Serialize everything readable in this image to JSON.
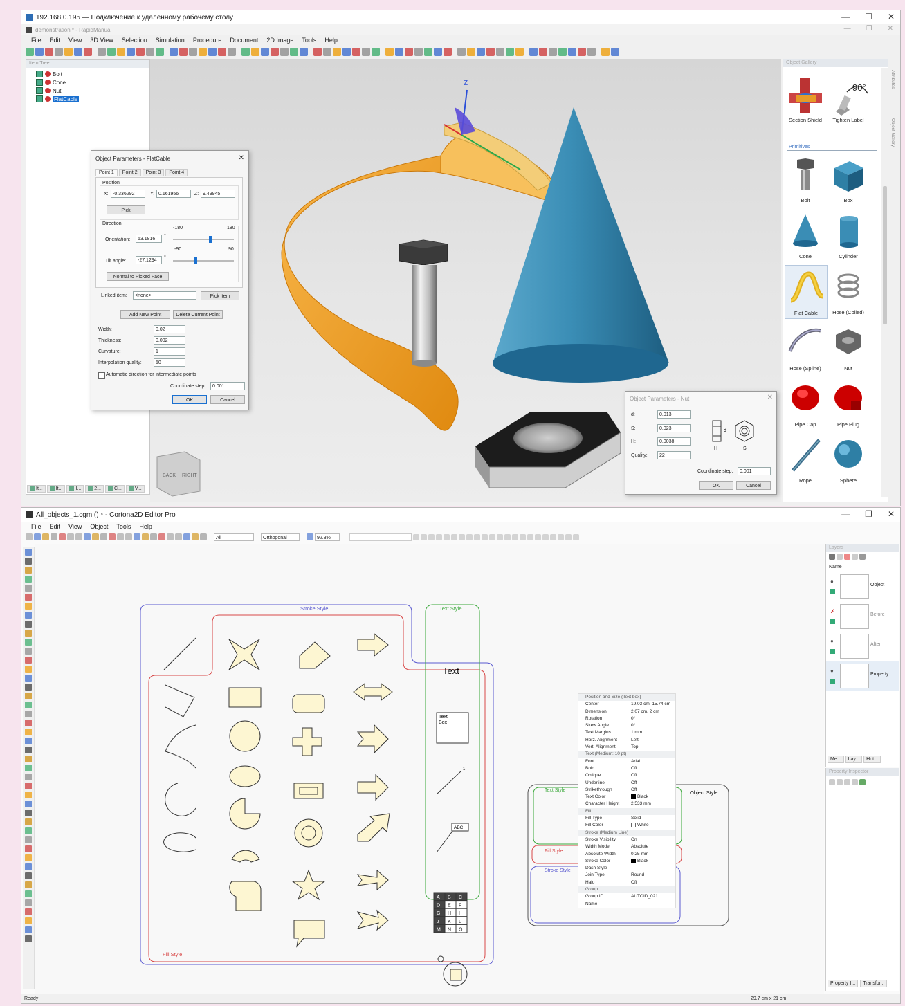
{
  "rapid": {
    "rdp_title": "192.168.0.195 — Подключение к удаленному рабочему столу",
    "app_title": "demonstration * - RapidManual",
    "menu": [
      "File",
      "Edit",
      "View",
      "3D View",
      "Selection",
      "Simulation",
      "Procedure",
      "Document",
      "2D Image",
      "Tools",
      "Help"
    ],
    "item_tree": {
      "title": "Item Tree",
      "items": [
        "Bolt",
        "Cone",
        "Nut",
        "FlatCable"
      ]
    },
    "flatcable_dialog": {
      "title": "Object Parameters - FlatCable",
      "tabs": [
        "Point 1",
        "Point 2",
        "Point 3",
        "Point 4"
      ],
      "position_label": "Position",
      "x_label": "X:",
      "x_value": "-0.336292",
      "y_label": "Y:",
      "y_value": "0.161956",
      "z_label": "Z:",
      "z_value": "9.49945",
      "pick": "Pick",
      "direction_label": "Direction",
      "orientation_label": "Orientation:",
      "orientation_value": "53.1816",
      "orientation_min": "-180",
      "orientation_max": "180",
      "tilt_label": "Tilt angle:",
      "tilt_value": "-27.1294",
      "tilt_min": "-90",
      "tilt_max": "90",
      "degree": "°",
      "normal_btn": "Normal to Picked Face",
      "linked_label": "Linked item:",
      "linked_value": "<none>",
      "pick_item": "Pick Item",
      "add_point": "Add New Point",
      "delete_point": "Delete Current Point",
      "width_label": "Width:",
      "width_value": "0.02",
      "thickness_label": "Thickness:",
      "thickness_value": "0.002",
      "curvature_label": "Curvature:",
      "curvature_value": "1",
      "interp_label": "Interpolation quality:",
      "interp_value": "50",
      "auto_dir": "Automatic direction for intermediate points",
      "coord_step_label": "Coordinate step:",
      "coord_step_value": "0.001",
      "ok": "OK",
      "cancel": "Cancel"
    },
    "nut_dialog": {
      "title": "Object Parameters - Nut",
      "d_label": "d:",
      "d_value": "0.013",
      "s_label": "S:",
      "s_value": "0.023",
      "h_label": "H:",
      "h_value": "0.0038",
      "q_label": "Quality:",
      "q_value": "22",
      "coord_step_label": "Coordinate step:",
      "coord_step_value": "0.001",
      "ok": "OK",
      "cancel": "Cancel",
      "dim_h": "H",
      "dim_d": "d",
      "dim_s": "S"
    },
    "viewcube": {
      "back": "BACK",
      "right": "RIGHT"
    },
    "axis_z": "Z",
    "gallery": {
      "title": "Object Gallery",
      "top_items": [
        "Section Shield",
        "Tighten Label"
      ],
      "tighten_text": "90°",
      "primitives_label": "Primitives",
      "items": [
        "Bolt",
        "Box",
        "Cone",
        "Cylinder",
        "Flat Cable",
        "Hose (Coiled)",
        "Hose (Spline)",
        "Nut",
        "Pipe Cap",
        "Pipe Plug",
        "Rope",
        "Sphere"
      ]
    },
    "bottom_tabs": [
      "It...",
      "It...",
      "I...",
      "2...",
      "C...",
      "V..."
    ],
    "side_tabs": [
      "Attributes",
      "Object Gallery"
    ]
  },
  "cortona": {
    "title": "All_objects_1.cgm () * - Cortona2D Editor Pro",
    "menu": [
      "File",
      "Edit",
      "View",
      "Object",
      "Tools",
      "Help"
    ],
    "toolbar": {
      "layer_select": "All",
      "view_mode": "Orthogonal",
      "zoom": "92.3%"
    },
    "canvas": {
      "stroke_style": "Stroke Style",
      "text_style": "Text Style",
      "fill_style": "Fill Style",
      "text_sample": "Text",
      "text_box": "Text\nBox",
      "callout_num": "1",
      "callout_abc": "ABC",
      "table_cells": [
        "A",
        "B",
        "C",
        "D",
        "E",
        "F",
        "G",
        "H",
        "I",
        "J",
        "K",
        "L",
        "M",
        "N",
        "O"
      ]
    },
    "property_sheet": {
      "object_style": "Object Style",
      "text_style": "Text Style",
      "fill_style": "Fill Style",
      "stroke_style": "Stroke Style",
      "rows": [
        {
          "s": "Position and Size (Text box)"
        },
        {
          "k": "Center",
          "v": "19.03 cm, 15.74 cm"
        },
        {
          "k": "Dimension",
          "v": "2.07 cm, 2 cm"
        },
        {
          "k": "Rotation",
          "v": "0°"
        },
        {
          "k": "Skew Angle",
          "v": "0°"
        },
        {
          "k": "Text Margins",
          "v": "1 mm"
        },
        {
          "k": "Horz. Alignment",
          "v": "Left"
        },
        {
          "k": "Vert. Alignment",
          "v": "Top"
        },
        {
          "s": "Text (Medium: 10 pt)"
        },
        {
          "k": "Font",
          "v": "Arial"
        },
        {
          "k": "Bold",
          "v": "Off"
        },
        {
          "k": "Oblique",
          "v": "Off"
        },
        {
          "k": "Underline",
          "v": "Off"
        },
        {
          "k": "Strikethrough",
          "v": "Off"
        },
        {
          "k": "Text Color",
          "v": "Black"
        },
        {
          "k": "Character Height",
          "v": "2.533 mm"
        },
        {
          "s": "Fill"
        },
        {
          "k": "Fill Type",
          "v": "Solid"
        },
        {
          "k": "Fill Color",
          "v": "White"
        },
        {
          "s": "Stroke (Medium Line)"
        },
        {
          "k": "Stroke Visibility",
          "v": "On"
        },
        {
          "k": "Width Mode",
          "v": "Absolute"
        },
        {
          "k": "Absolute Width",
          "v": "0.25 mm"
        },
        {
          "k": "Stroke Color",
          "v": "Black"
        },
        {
          "k": "Dash Style",
          "v": ""
        },
        {
          "k": "Join Type",
          "v": "Round"
        },
        {
          "k": "Halo",
          "v": "Off"
        },
        {
          "s": "Group"
        },
        {
          "k": "Group ID",
          "v": "AUTOID_021"
        },
        {
          "k": "Name",
          "v": ""
        }
      ]
    },
    "layers": {
      "title": "Layers",
      "name_col": "Name",
      "labels": [
        "Object",
        "Before",
        "After",
        "Property"
      ],
      "tabs": [
        "Me...",
        "Lay...",
        "Hot..."
      ]
    },
    "property_inspector": {
      "title": "Property Inspector",
      "tabs": [
        "Property I...",
        "Transfor..."
      ]
    },
    "status": {
      "ready": "Ready",
      "size": "29.7 cm x 21 cm"
    }
  },
  "colors": {
    "cable": "#f5a623",
    "cone": "#2e7fa5",
    "canvas_blue": "#5a5ad0",
    "canvas_red": "#d84848",
    "canvas_green": "#3aa83a",
    "shape_fill": "#fdf6d2",
    "selection": "#1a70d0"
  }
}
